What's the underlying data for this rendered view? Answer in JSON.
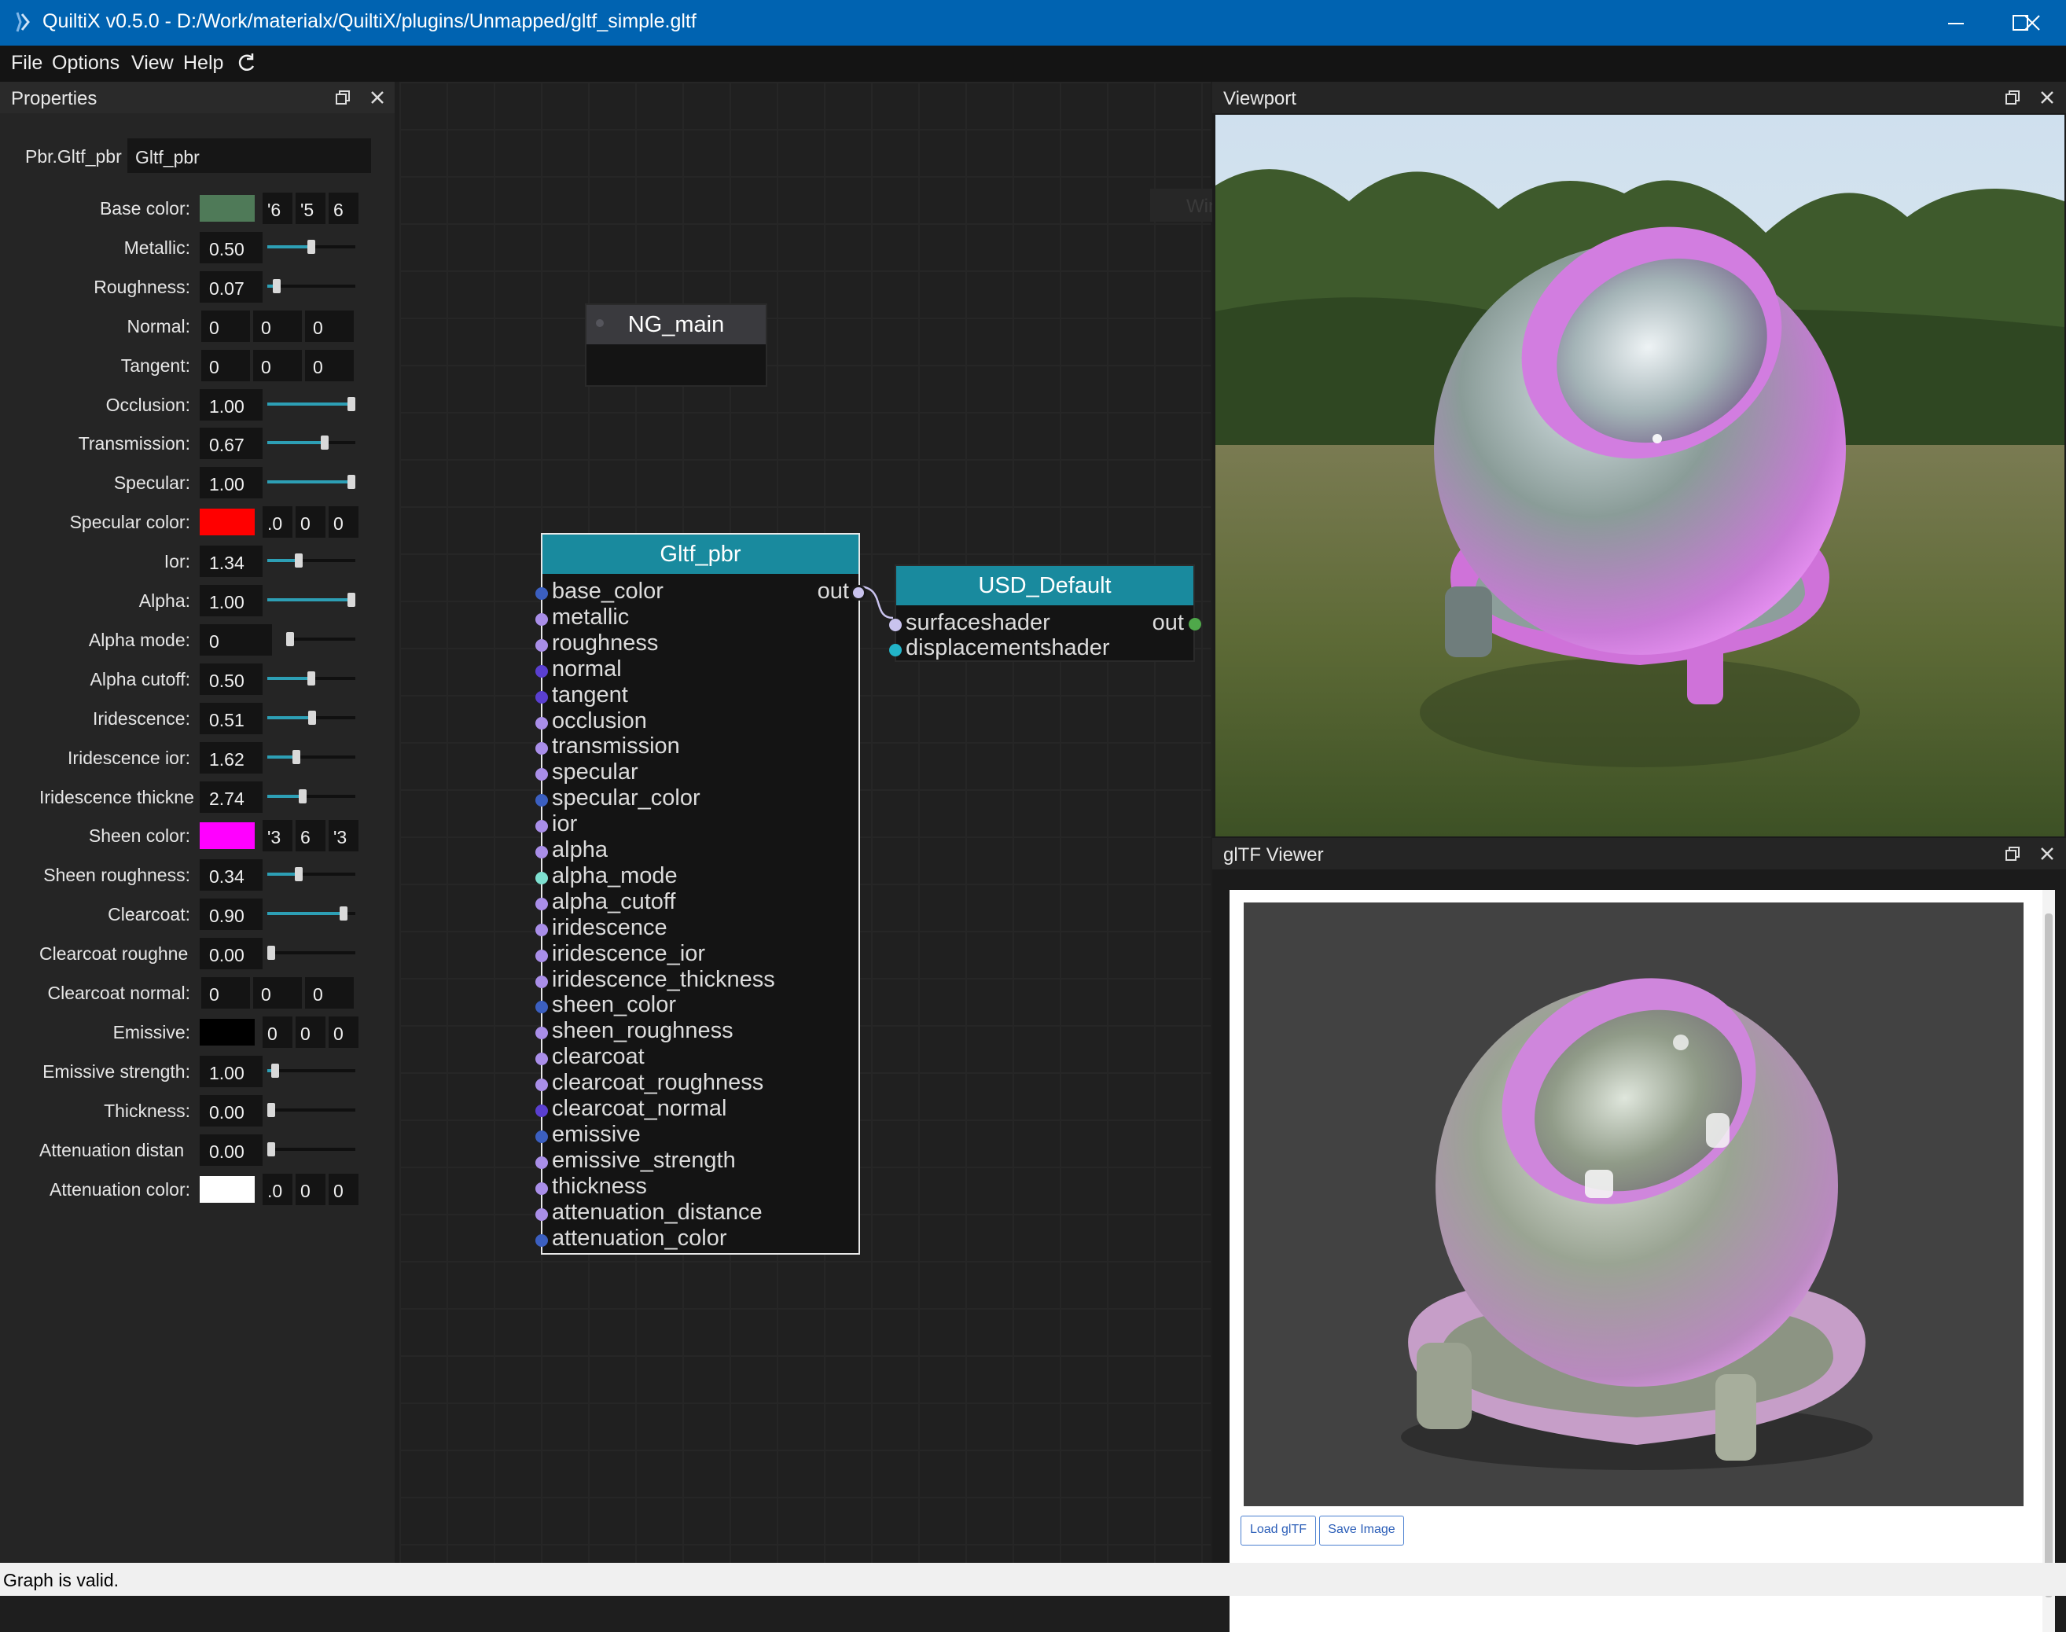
{
  "window": {
    "title": "QuiltiX v0.5.0 - D:/Work/materialx/QuiltiX/plugins/Unmapped/gltf_simple.gltf"
  },
  "menu": [
    "File",
    "Options",
    "View",
    "Help"
  ],
  "panels": {
    "properties": "Properties",
    "viewport": "Viewport",
    "gltf_viewer": "glTF Viewer"
  },
  "node_type": {
    "label": "Pbr.Gltf_pbr",
    "value": "Gltf_pbr"
  },
  "properties": [
    {
      "label": "Base color:",
      "kind": "color",
      "color": "#4f7a58",
      "parts": [
        "'6",
        "'5",
        "6"
      ]
    },
    {
      "label": "Metallic:",
      "kind": "slider",
      "value": "0.50",
      "level": 0.5
    },
    {
      "label": "Roughness:",
      "kind": "slider",
      "value": "0.07",
      "level": 0.07
    },
    {
      "label": "Normal:",
      "kind": "vector",
      "parts": [
        "0",
        "0",
        "0"
      ]
    },
    {
      "label": "Tangent:",
      "kind": "vector",
      "parts": [
        "0",
        "0",
        "0"
      ]
    },
    {
      "label": "Occlusion:",
      "kind": "slider",
      "value": "1.00",
      "level": 1.0
    },
    {
      "label": "Transmission:",
      "kind": "slider",
      "value": "0.67",
      "level": 0.67
    },
    {
      "label": "Specular:",
      "kind": "slider",
      "value": "1.00",
      "level": 1.0
    },
    {
      "label": "Specular color:",
      "kind": "color",
      "color": "#ff0000",
      "parts": [
        ".0",
        "0",
        "0"
      ]
    },
    {
      "label": "Ior:",
      "kind": "slider",
      "value": "1.34",
      "level": 0.34
    },
    {
      "label": "Alpha:",
      "kind": "slider",
      "value": "1.00",
      "level": 1.0
    },
    {
      "label": "Alpha mode:",
      "kind": "slider-short",
      "value": "0",
      "level": 0.0
    },
    {
      "label": "Alpha cutoff:",
      "kind": "slider",
      "value": "0.50",
      "level": 0.5
    },
    {
      "label": "Iridescence:",
      "kind": "slider",
      "value": "0.51",
      "level": 0.51
    },
    {
      "label": "Iridescence ior:",
      "kind": "slider",
      "value": "1.62",
      "level": 0.31
    },
    {
      "label": "Iridescence thickne",
      "kind": "slider",
      "value": "2.74",
      "level": 0.39,
      "clip": true
    },
    {
      "label": "Sheen color:",
      "kind": "color",
      "color": "#ff00ff",
      "parts": [
        "'3",
        "6",
        "'3"
      ]
    },
    {
      "label": "Sheen roughness:",
      "kind": "slider",
      "value": "0.34",
      "level": 0.34
    },
    {
      "label": "Clearcoat:",
      "kind": "slider",
      "value": "0.90",
      "level": 0.9
    },
    {
      "label": "Clearcoat roughne",
      "kind": "slider",
      "value": "0.00",
      "level": 0.0,
      "clip": true
    },
    {
      "label": "Clearcoat normal:",
      "kind": "vector",
      "parts": [
        "0",
        "0",
        "0"
      ]
    },
    {
      "label": "Emissive:",
      "kind": "color",
      "color": "#000000",
      "parts": [
        "0",
        "0",
        "0"
      ]
    },
    {
      "label": "Emissive strength:",
      "kind": "slider",
      "value": "1.00",
      "level": 0.05
    },
    {
      "label": "Thickness:",
      "kind": "slider",
      "value": "0.00",
      "level": 0.0
    },
    {
      "label": "Attenuation distan",
      "kind": "slider",
      "value": "0.00",
      "level": 0.0,
      "clip": true
    },
    {
      "label": "Attenuation color:",
      "kind": "color",
      "color": "#ffffff",
      "parts": [
        ".0",
        "0",
        "0"
      ]
    }
  ],
  "graph": {
    "ghost_text": "Window Snip",
    "ng_main": {
      "title": "NG_main"
    },
    "gltf_pbr": {
      "title": "Gltf_pbr",
      "output": "out",
      "inputs": [
        {
          "name": "base_color",
          "color": "#3b5fc0"
        },
        {
          "name": "metallic",
          "color": "#a98ee8"
        },
        {
          "name": "roughness",
          "color": "#a98ee8"
        },
        {
          "name": "normal",
          "color": "#5a3fd0"
        },
        {
          "name": "tangent",
          "color": "#5a3fd0"
        },
        {
          "name": "occlusion",
          "color": "#a98ee8"
        },
        {
          "name": "transmission",
          "color": "#a98ee8"
        },
        {
          "name": "specular",
          "color": "#a98ee8"
        },
        {
          "name": "specular_color",
          "color": "#3b5fc0"
        },
        {
          "name": "ior",
          "color": "#a98ee8"
        },
        {
          "name": "alpha",
          "color": "#a98ee8"
        },
        {
          "name": "alpha_mode",
          "color": "#7ee0d0"
        },
        {
          "name": "alpha_cutoff",
          "color": "#a98ee8"
        },
        {
          "name": "iridescence",
          "color": "#a98ee8"
        },
        {
          "name": "iridescence_ior",
          "color": "#a98ee8"
        },
        {
          "name": "iridescence_thickness",
          "color": "#a98ee8"
        },
        {
          "name": "sheen_color",
          "color": "#3b5fc0"
        },
        {
          "name": "sheen_roughness",
          "color": "#a98ee8"
        },
        {
          "name": "clearcoat",
          "color": "#a98ee8"
        },
        {
          "name": "clearcoat_roughness",
          "color": "#a98ee8"
        },
        {
          "name": "clearcoat_normal",
          "color": "#5a3fd0"
        },
        {
          "name": "emissive",
          "color": "#3b5fc0"
        },
        {
          "name": "emissive_strength",
          "color": "#a98ee8"
        },
        {
          "name": "thickness",
          "color": "#a98ee8"
        },
        {
          "name": "attenuation_distance",
          "color": "#a98ee8"
        },
        {
          "name": "attenuation_color",
          "color": "#3b5fc0"
        }
      ]
    },
    "usd_default": {
      "title": "USD_Default",
      "output": "out",
      "inputs": [
        {
          "name": "surfaceshader",
          "color": "#c9c3ee"
        },
        {
          "name": "displacementshader",
          "color": "#22b4c8"
        }
      ]
    }
  },
  "viewer": {
    "load_label": "Load glTF",
    "save_label": "Save Image"
  },
  "status": "Graph is valid.",
  "colors": {
    "accent": "#198a9e",
    "titlebar": "#0063b1"
  }
}
